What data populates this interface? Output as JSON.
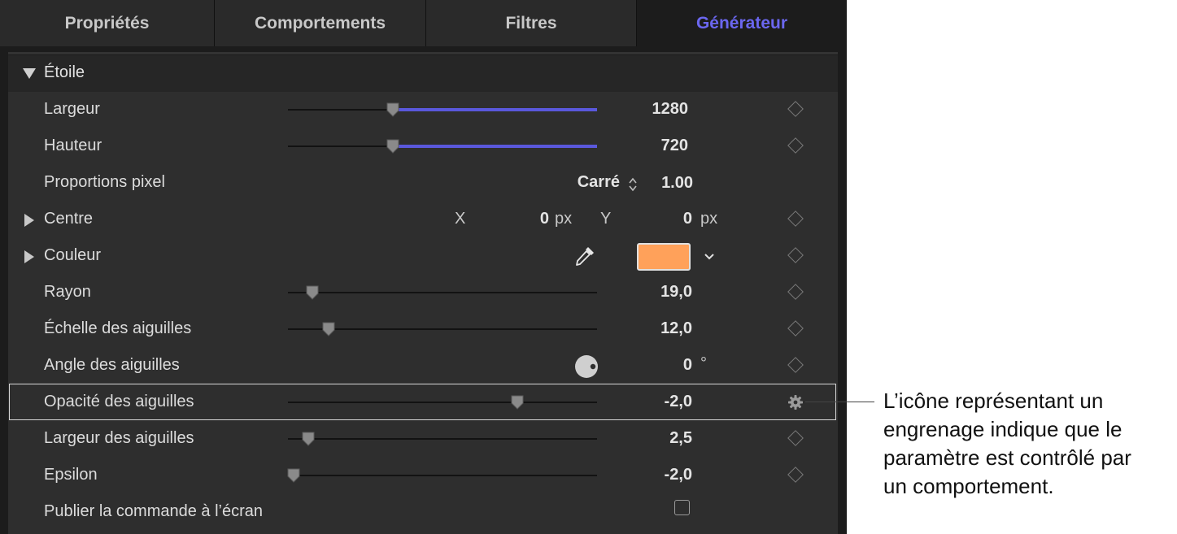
{
  "tabs": [
    {
      "label": "Propriétés",
      "active": false
    },
    {
      "label": "Comportements",
      "active": false
    },
    {
      "label": "Filtres",
      "active": false
    },
    {
      "label": "Générateur",
      "active": true
    }
  ],
  "group": {
    "title": "Étoile",
    "expanded": true
  },
  "params": {
    "largeur": {
      "label": "Largeur",
      "value": "1280",
      "slider_fraction": 0.34
    },
    "hauteur": {
      "label": "Hauteur",
      "value": "720",
      "slider_fraction": 0.34
    },
    "proportions": {
      "label": "Proportions pixel",
      "selected": "Carré",
      "value": "1.00"
    },
    "centre": {
      "label": "Centre",
      "x_label": "X",
      "x_value": "0",
      "x_unit": "px",
      "y_label": "Y",
      "y_value": "0",
      "y_unit": "px"
    },
    "couleur": {
      "label": "Couleur",
      "swatch_color": "#ffa15a"
    },
    "rayon": {
      "label": "Rayon",
      "value": "19,0",
      "slider_fraction": 0.08
    },
    "echelle": {
      "label": "Échelle des aiguilles",
      "value": "12,0",
      "slider_fraction": 0.13
    },
    "angle": {
      "label": "Angle des aiguilles",
      "value": "0",
      "unit": "°"
    },
    "opacite": {
      "label": "Opacité des aiguilles",
      "value": "-2,0",
      "slider_fraction": 0.74
    },
    "largeur_aiguilles": {
      "label": "Largeur des aiguilles",
      "value": "2,5",
      "slider_fraction": 0.06
    },
    "epsilon": {
      "label": "Epsilon",
      "value": "-2,0",
      "slider_fraction": 0.02
    },
    "publier": {
      "label": "Publier la commande à l’écran",
      "checked": false
    }
  },
  "callout": {
    "lines": [
      "L’icône représentant un",
      "engrenage indique que le",
      "paramètre est contrôlé par",
      "un comportement."
    ]
  },
  "colors": {
    "accent": "#6b67f0",
    "slider_fill": "#5a58dc",
    "panel": "#2e2e2e"
  },
  "icons": {
    "keyframe": "diamond-keyframe-icon",
    "behavior": "gear-icon",
    "eyedropper": "eyedropper-icon",
    "dial": "angle-dial-icon"
  }
}
